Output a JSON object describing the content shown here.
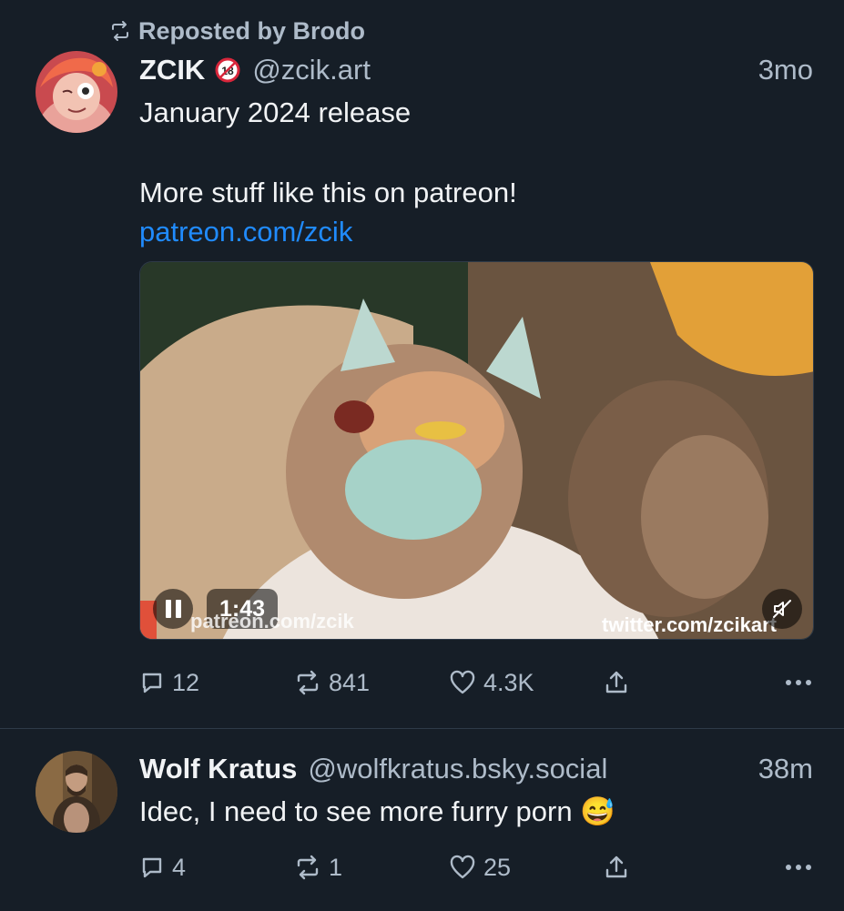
{
  "colors": {
    "background": "#161e27",
    "text_primary": "#f1f3f5",
    "text_secondary": "#aebbc9",
    "link": "#208bfe",
    "divider": "#2e3a48"
  },
  "posts": [
    {
      "repost": {
        "icon": "repost-icon",
        "label": "Reposted by Brodo"
      },
      "author": {
        "display_name": "ZCIK",
        "badge_icon": "adult-content-18-icon",
        "handle": "@zcik.art"
      },
      "timestamp": "3mo",
      "text": {
        "line1": "January 2024 release",
        "line2": "More stuff like this on patreon!",
        "link": "patreon.com/zcik"
      },
      "video": {
        "state": "playing",
        "duration": "1:43",
        "watermark_left": "patreon.com/zcik",
        "watermark_right": "twitter.com/zcikart",
        "muted": true
      },
      "actions": {
        "replies": "12",
        "reposts": "841",
        "likes": "4.3K"
      }
    },
    {
      "author": {
        "display_name": "Wolf Kratus",
        "handle": "@wolfkratus.bsky.social"
      },
      "timestamp": "38m",
      "text": {
        "line1": "Idec, I need to see more furry porn 😅"
      },
      "actions": {
        "replies": "4",
        "reposts": "1",
        "likes": "25"
      }
    }
  ]
}
